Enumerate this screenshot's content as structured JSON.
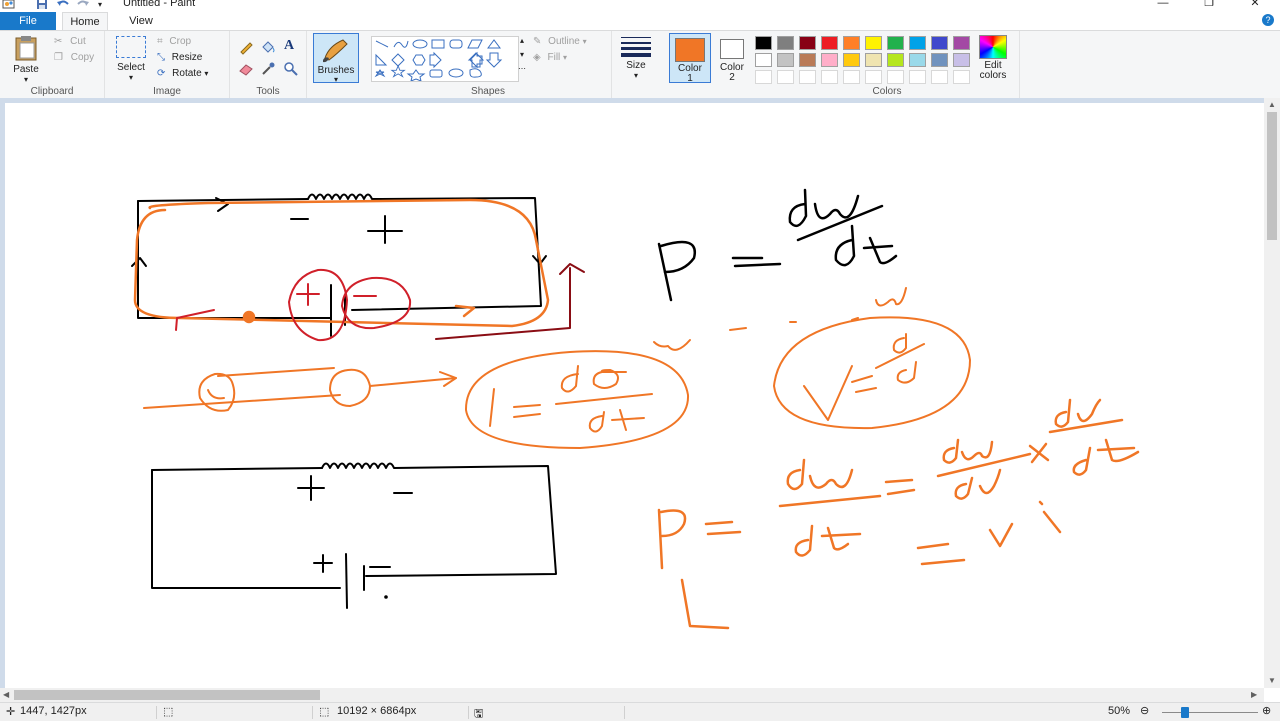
{
  "window": {
    "title": "Untitled - Paint",
    "minimize_glyph": "—",
    "restore_glyph": "❐",
    "close_glyph": "✕"
  },
  "tabs": {
    "file": "File",
    "home": "Home",
    "view": "View",
    "help_glyph": "?"
  },
  "ribbon": {
    "clipboard": {
      "label": "Clipboard",
      "paste": "Paste",
      "cut": "Cut",
      "copy": "Copy"
    },
    "image": {
      "label": "Image",
      "select": "Select",
      "crop": "Crop",
      "resize": "Resize",
      "rotate": "Rotate"
    },
    "tools": {
      "label": "Tools"
    },
    "brushes": {
      "label": "Brushes"
    },
    "shapes": {
      "label": "Shapes",
      "outline": "Outline",
      "fill": "Fill"
    },
    "size": {
      "label": "Size"
    },
    "color1": {
      "label": "Color 1",
      "value": "#f07626"
    },
    "color2": {
      "label": "Color 2",
      "value": "#ffffff"
    },
    "colors": {
      "label": "Colors",
      "edit": "Edit colors"
    },
    "palette": [
      "#000000",
      "#7f7f7f",
      "#880015",
      "#ed1c24",
      "#ff7f27",
      "#fff200",
      "#22b14c",
      "#00a2e8",
      "#3f48cc",
      "#a349a4",
      "#ffffff",
      "#c3c3c3",
      "#b97a57",
      "#ffaec9",
      "#ffc90e",
      "#efe4b0",
      "#b5e61d",
      "#99d9ea",
      "#7092be",
      "#c8bfe7",
      "#ffffff",
      "#ffffff",
      "#ffffff",
      "#ffffff",
      "#ffffff",
      "#ffffff",
      "#ffffff",
      "#ffffff",
      "#ffffff",
      "#ffffff"
    ]
  },
  "drawing": {
    "ink_orange": "#f07626",
    "ink_black": "#000000",
    "ink_red": "#d0202a",
    "ink_darkred": "#8a0d14"
  },
  "status": {
    "cursor_pos": "1447, 1427px",
    "canvas_size": "10192 × 6864px",
    "zoom": "50%",
    "zoom_level": 0.5
  }
}
